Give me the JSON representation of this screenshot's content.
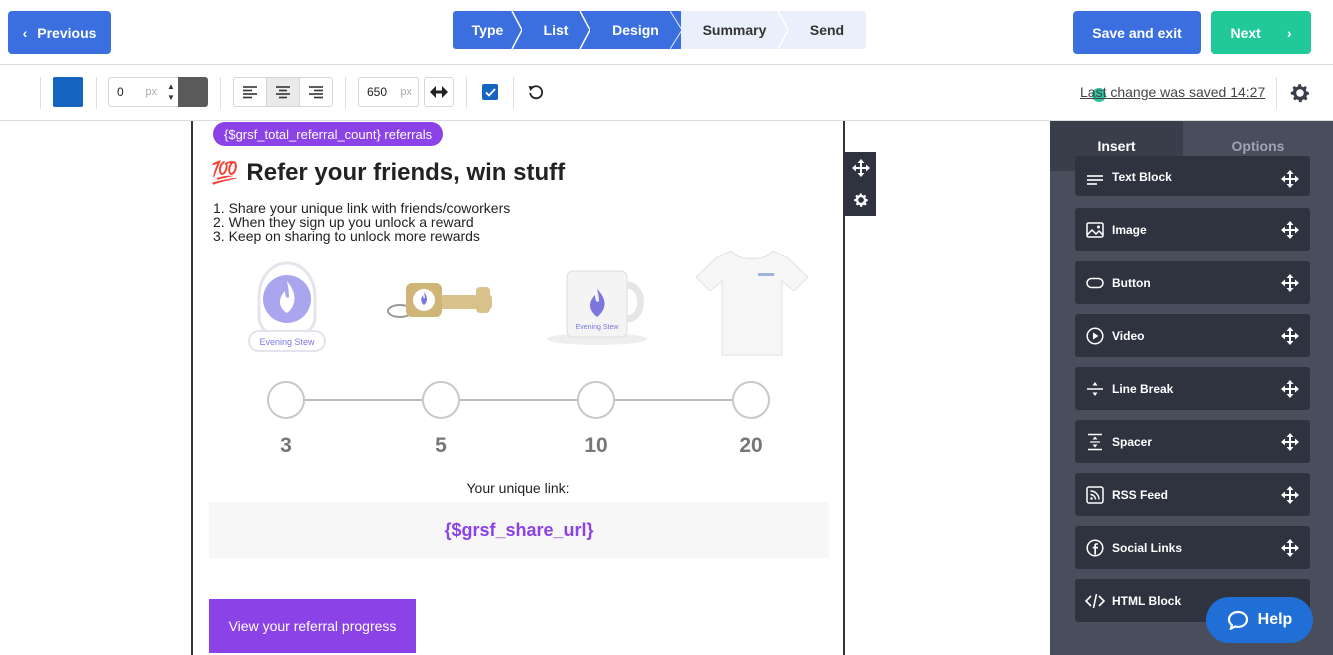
{
  "header": {
    "previous_label": "Previous",
    "save_exit_label": "Save and exit",
    "next_label": "Next",
    "prev_chevron": "‹",
    "next_chevron": "›",
    "steps": [
      {
        "label": "Type",
        "state": "active"
      },
      {
        "label": "List",
        "state": "active"
      },
      {
        "label": "Design",
        "state": "active"
      },
      {
        "label": "Summary",
        "state": "inactive"
      },
      {
        "label": "Send",
        "state": "inactive"
      }
    ]
  },
  "toolbar": {
    "background_color": "#1565c0",
    "border_width_value": "0",
    "border_width_unit": "px",
    "border_color": "#5a5a5a",
    "alignment": "center",
    "width_value": "650",
    "width_unit": "px",
    "full_width_checked": true,
    "saved_status": "Last change was saved 14:27"
  },
  "email": {
    "pill_text": "{$grsf_total_referral_count} referrals",
    "headline_emoji": "💯",
    "headline": "Refer your friends, win stuff",
    "instructions": [
      "1. Share your unique link with friends/coworkers",
      "2. When they sign up you unlock a reward",
      "3. Keep on sharing to unlock more rewards"
    ],
    "rewards": [
      {
        "name": "sticker",
        "caption": "Evening Stew"
      },
      {
        "name": "keychain-tool",
        "caption": ""
      },
      {
        "name": "mug",
        "caption": "Evening Stew"
      },
      {
        "name": "t-shirt",
        "caption": ""
      }
    ],
    "milestones": [
      "3",
      "5",
      "10",
      "20"
    ],
    "link_label": "Your unique link:",
    "share_url": "{$grsf_share_url}",
    "cta_label": "View your referral progress",
    "accent_color": "#8b42e6"
  },
  "panel": {
    "tabs": [
      {
        "label": "Insert",
        "state": "active"
      },
      {
        "label": "Options",
        "state": "inactive"
      }
    ],
    "blocks": [
      {
        "label": "Text Block",
        "icon": "text-lines-icon"
      },
      {
        "label": "Image",
        "icon": "image-icon"
      },
      {
        "label": "Button",
        "icon": "button-icon"
      },
      {
        "label": "Video",
        "icon": "play-icon"
      },
      {
        "label": "Line Break",
        "icon": "line-break-icon"
      },
      {
        "label": "Spacer",
        "icon": "spacer-icon"
      },
      {
        "label": "RSS Feed",
        "icon": "rss-icon"
      },
      {
        "label": "Social Links",
        "icon": "facebook-icon"
      },
      {
        "label": "HTML Block",
        "icon": "code-icon"
      }
    ]
  },
  "help_label": "Help"
}
